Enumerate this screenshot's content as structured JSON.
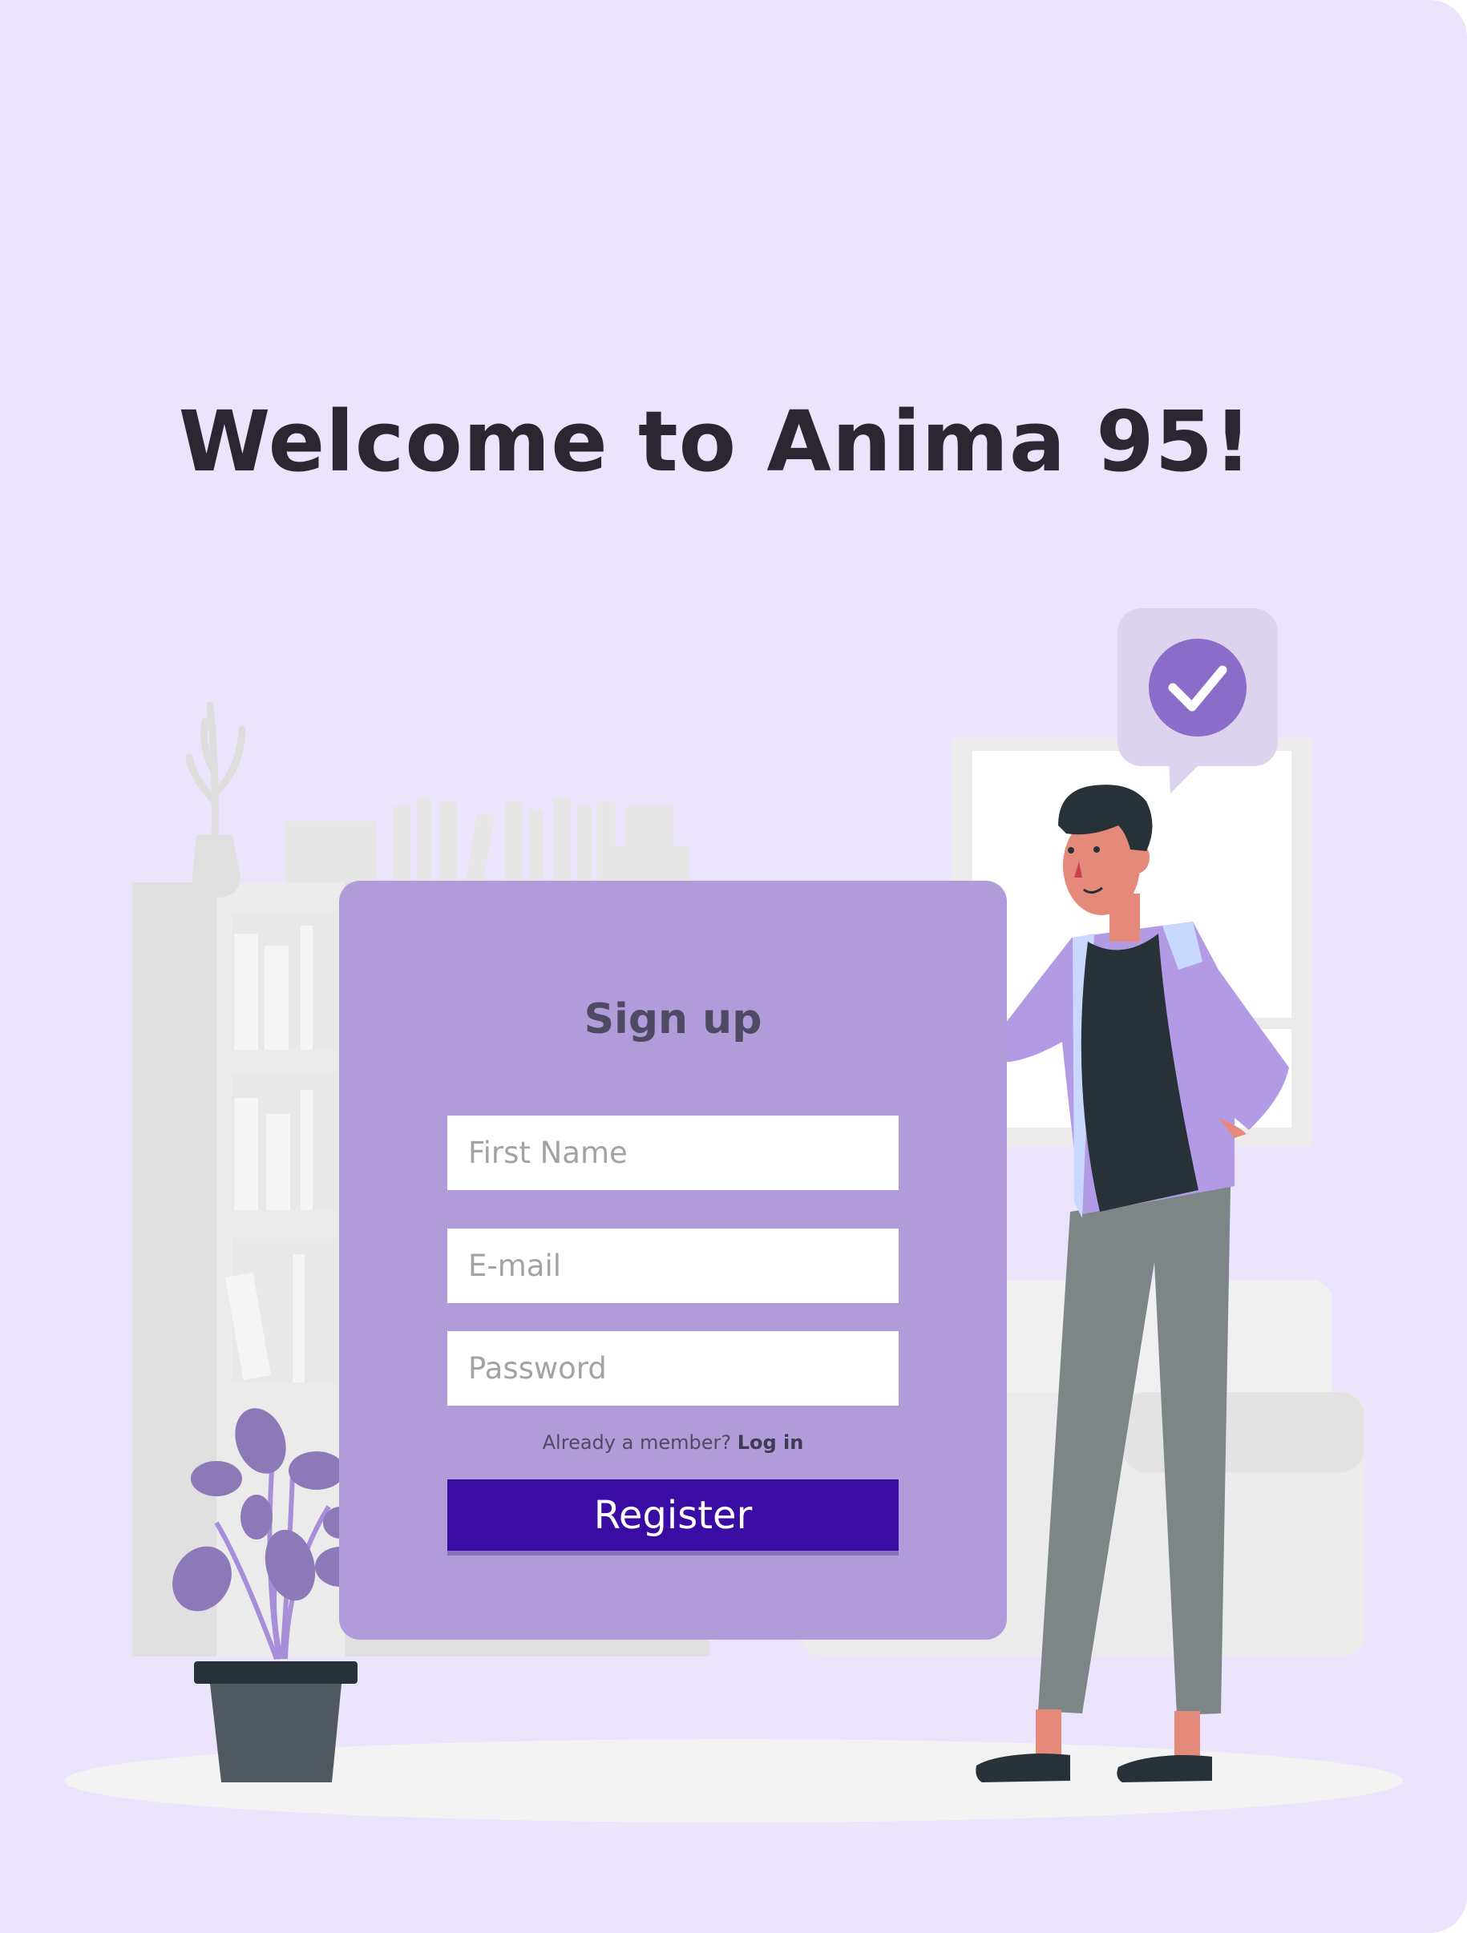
{
  "heading": "Welcome to Anima 95!",
  "signup": {
    "title": "Sign up",
    "first_name_placeholder": "First Name",
    "email_placeholder": "E-mail",
    "password_placeholder": "Password",
    "already_member": "Already a member? ",
    "login_link": "Log in",
    "register_label": "Register"
  },
  "colors": {
    "background": "#ece3fd",
    "card": "#b09cd8",
    "button": "#3a0ca3",
    "check_badge": "#8b6cc8"
  },
  "illustration": {
    "icons": [
      "check-circle-icon",
      "speech-bubble",
      "person-figure",
      "potted-plant",
      "bookshelf",
      "sofa",
      "window"
    ]
  }
}
